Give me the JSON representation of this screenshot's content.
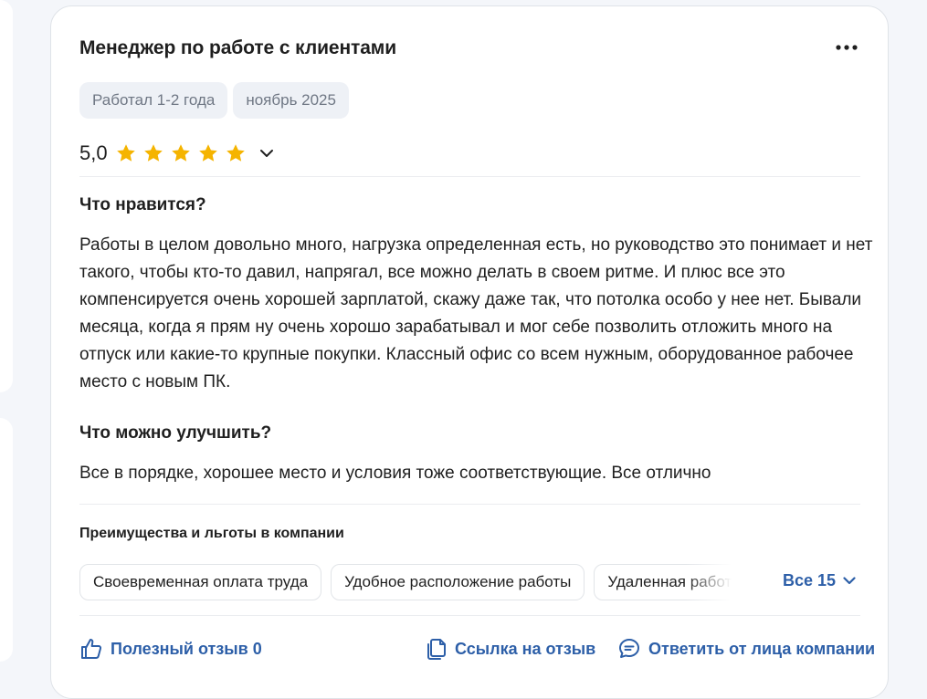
{
  "review": {
    "title": "Менеджер по работе с клиентами",
    "tags": [
      "Работал 1-2 года",
      "ноябрь 2025"
    ],
    "rating": {
      "value_label": "5,0",
      "stars": 5,
      "max_stars": 5,
      "star_color": "#f5b400"
    },
    "likes_title": "Что нравится?",
    "likes_text": "Работы в целом довольно много, нагрузка определенная есть, но руководство это понимает и нет такого, чтобы кто-то давил, напрягал, все можно делать в своем ритме. И плюс все это компенсируется очень хорошей зарплатой, скажу даже так, что потолка особо у нее нет. Бывали месяца, когда я прям ну очень хорошо зарабатывал и мог себе позволить отложить много на отпуск или какие-то крупные покупки. Классный офис со всем нужным, оборудованное рабочее место с новым ПК.",
    "improve_title": "Что можно улучшить?",
    "improve_text": "Все в порядке, хорошее место и условия тоже соответствующие. Все отлично"
  },
  "benefits": {
    "title": "Преимущества и льготы в компании",
    "items": [
      "Своевременная оплата труда",
      "Удобное расположение работы",
      "Удаленная работа"
    ],
    "show_all_label": "Все 15"
  },
  "actions": {
    "helpful_label": "Полезный отзыв 0",
    "link_label": "Ссылка на отзыв",
    "reply_label": "Ответить от лица компании"
  },
  "icons": {
    "more": "more-dots-icon",
    "rating_toggle": "chevron-down-icon",
    "show_all": "chevron-down-icon",
    "helpful": "thumbs-up-icon",
    "link": "copy-link-icon",
    "reply": "chat-bubble-icon"
  },
  "colors": {
    "accent": "#2d5fa8",
    "star": "#f5b400",
    "tag_bg": "#eef1f6",
    "tag_text": "#6f7784"
  }
}
